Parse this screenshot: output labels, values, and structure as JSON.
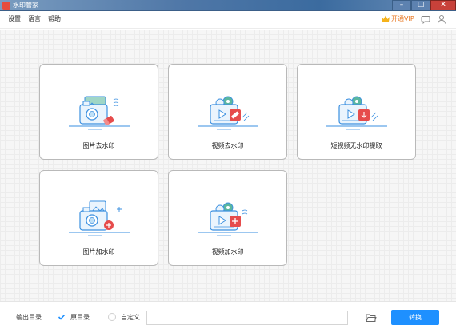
{
  "window": {
    "title": "水印管家"
  },
  "menu": {
    "items": [
      "设置",
      "语言",
      "帮助"
    ],
    "vip_label": "开通VIP"
  },
  "cards": [
    {
      "label": "图片去水印",
      "icon": "image-remove-watermark-icon"
    },
    {
      "label": "视频去水印",
      "icon": "video-remove-watermark-icon"
    },
    {
      "label": "短视频无水印提取",
      "icon": "short-video-extract-icon"
    },
    {
      "label": "图片加水印",
      "icon": "image-add-watermark-icon"
    },
    {
      "label": "视频加水印",
      "icon": "video-add-watermark-icon"
    }
  ],
  "footer": {
    "output_dir_label": "输出目录",
    "option_original": "原目录",
    "option_custom": "自定义",
    "path_value": "",
    "convert_label": "转换"
  },
  "colors": {
    "accent": "#1e90ff",
    "vip": "#e8741c",
    "illus_blue": "#3a8fe0",
    "illus_red": "#e64c4c",
    "illus_teal": "#5ab7a0"
  }
}
